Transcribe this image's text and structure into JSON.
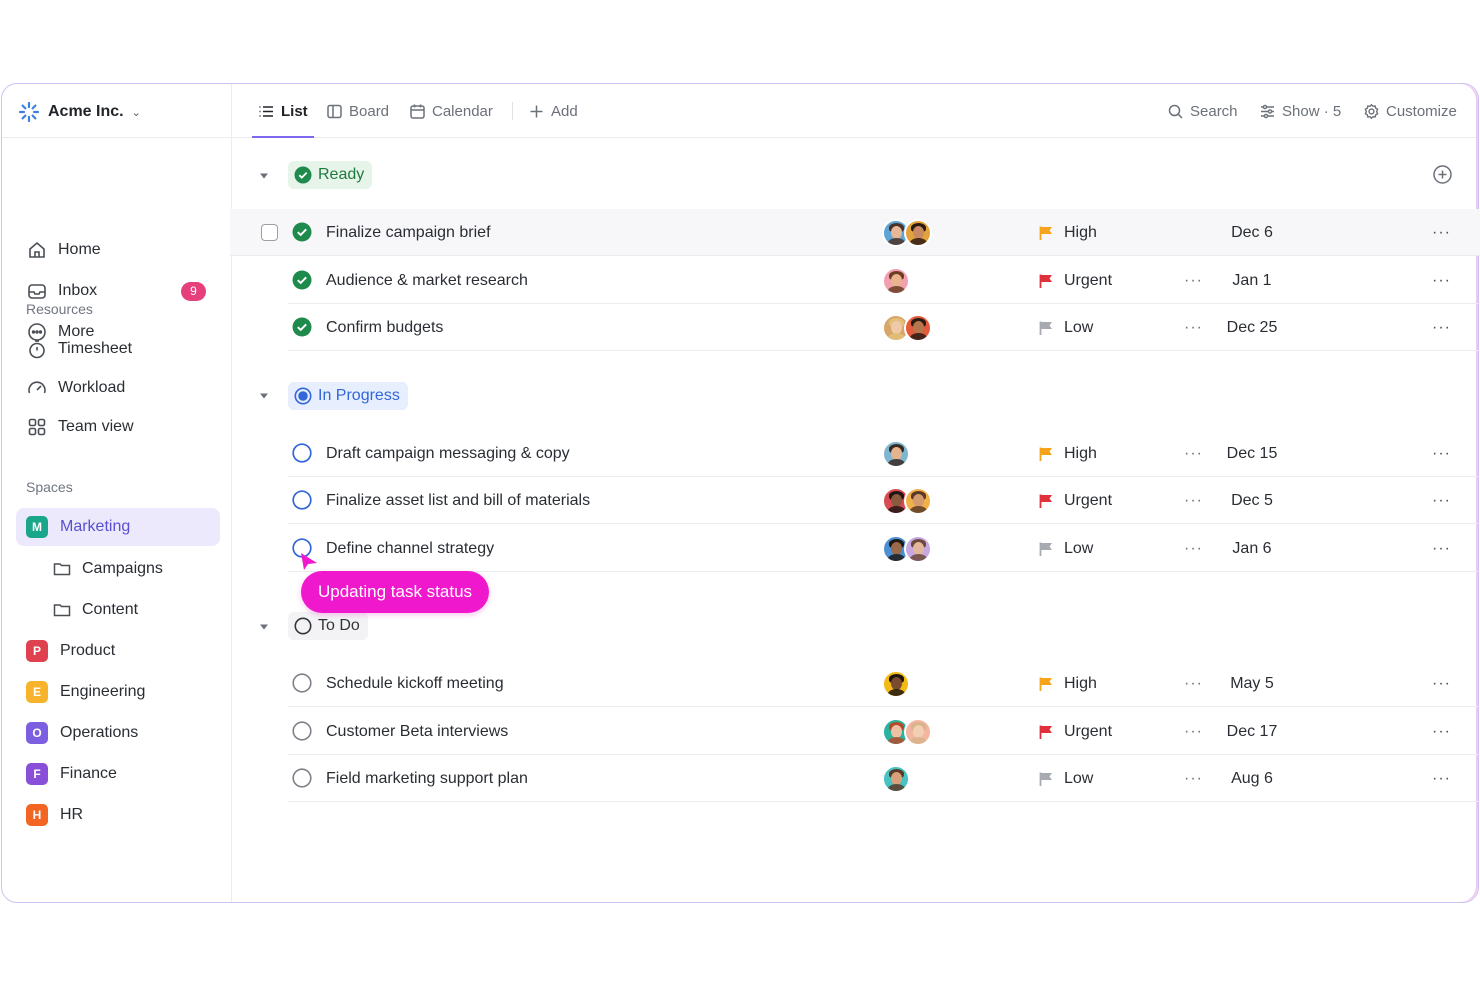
{
  "workspace": {
    "name": "Acme Inc."
  },
  "nav": [
    {
      "label": "Home",
      "icon": "home-icon"
    },
    {
      "label": "Inbox",
      "icon": "inbox-icon",
      "badge": "9"
    },
    {
      "label": "More",
      "icon": "more-icon"
    }
  ],
  "resources": {
    "label": "Resources",
    "items": [
      {
        "label": "Timesheet",
        "icon": "timer-icon"
      },
      {
        "label": "Workload",
        "icon": "gauge-icon"
      },
      {
        "label": "Team view",
        "icon": "grid-icon"
      }
    ]
  },
  "spaces": {
    "label": "Spaces",
    "items": [
      {
        "letter": "M",
        "label": "Marketing",
        "color": "#1aa68a",
        "active": true
      },
      {
        "letter": "P",
        "label": "Product",
        "color": "#e0414f"
      },
      {
        "letter": "E",
        "label": "Engineering",
        "color": "#f7b32b"
      },
      {
        "letter": "O",
        "label": "Operations",
        "color": "#7b5fe0"
      },
      {
        "letter": "F",
        "label": "Finance",
        "color": "#8a4fd8"
      },
      {
        "letter": "H",
        "label": "HR",
        "color": "#f26522"
      }
    ],
    "folders": [
      {
        "label": "Campaigns"
      },
      {
        "label": "Content"
      }
    ]
  },
  "toolbar": {
    "tabs": [
      {
        "label": "List",
        "icon": "list-icon",
        "active": true
      },
      {
        "label": "Board",
        "icon": "board-icon"
      },
      {
        "label": "Calendar",
        "icon": "calendar-icon"
      }
    ],
    "add_label": "Add",
    "search_label": "Search",
    "show_label": "Show · 5",
    "customize_label": "Customize"
  },
  "groups": [
    {
      "status": "Ready",
      "tasks": [
        {
          "name": "Finalize campaign brief",
          "priority": "High",
          "due": "Dec 6",
          "flag": "#f8a31c",
          "avatars": 2
        },
        {
          "name": "Audience & market research",
          "priority": "Urgent",
          "due": "Jan 1",
          "flag": "#e0303c",
          "avatars": 1
        },
        {
          "name": "Confirm budgets",
          "priority": "Low",
          "due": "Dec 25",
          "flag": "#a7aab0",
          "avatars": 2
        }
      ]
    },
    {
      "status": "In Progress",
      "tasks": [
        {
          "name": "Draft campaign messaging & copy",
          "priority": "High",
          "due": "Dec 15",
          "flag": "#f8a31c",
          "avatars": 1
        },
        {
          "name": "Finalize asset list and bill of materials",
          "priority": "Urgent",
          "due": "Dec 5",
          "flag": "#e0303c",
          "avatars": 2
        },
        {
          "name": "Define channel strategy",
          "priority": "Low",
          "due": "Jan 6",
          "flag": "#a7aab0",
          "avatars": 2
        }
      ]
    },
    {
      "status": "To Do",
      "tasks": [
        {
          "name": "Schedule kickoff meeting",
          "priority": "High",
          "due": "May 5",
          "flag": "#f8a31c",
          "avatars": 1
        },
        {
          "name": "Customer Beta interviews",
          "priority": "Urgent",
          "due": "Dec 17",
          "flag": "#e0303c",
          "avatars": 2
        },
        {
          "name": "Field marketing support plan",
          "priority": "Low",
          "due": "Aug 6",
          "flag": "#a7aab0",
          "avatars": 1
        }
      ]
    }
  ],
  "tooltip": {
    "text": "Updating task status"
  },
  "colors": {
    "accent": "#7b68ee",
    "ready": "#1f7a3f",
    "in_progress": "#3266d9",
    "tooltip": "#f018cd"
  }
}
